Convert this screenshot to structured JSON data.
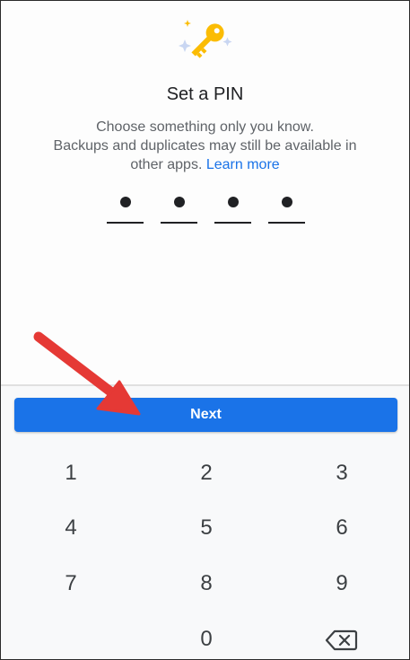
{
  "screen": {
    "title": "Set a PIN",
    "description_line1": "Choose something only you know.",
    "description_line2": "Backups and duplicates may still be available in",
    "description_line3": "other apps.",
    "learn_more": "Learn more",
    "pin_digits_entered": 4
  },
  "actions": {
    "next_label": "Next"
  },
  "keypad": {
    "k1": "1",
    "k2": "2",
    "k3": "3",
    "k4": "4",
    "k5": "5",
    "k6": "6",
    "k7": "7",
    "k8": "8",
    "k9": "9",
    "k0": "0",
    "backspace_icon": "backspace-icon"
  },
  "icons": {
    "illustration": "key-icon",
    "annotation": "red-arrow"
  },
  "colors": {
    "accent": "#1a73e8",
    "key_yellow": "#fbbc04",
    "arrow_red": "#e53935",
    "text_primary": "#202124",
    "text_secondary": "#5f6368"
  }
}
